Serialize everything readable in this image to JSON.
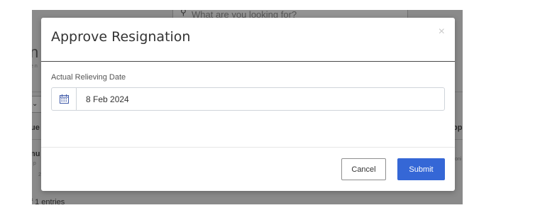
{
  "background": {
    "search_placeholder": "What are you looking for?",
    "fragment_heading": "n",
    "fragment_header_left": "ue",
    "fragment_header_right": "pp",
    "fragment_row_name": "nu",
    "fragment_row_sub": "d p",
    "fragment_row_num": "2",
    "fragment_right_small": "oni",
    "fragment_entries": "f 1 entries",
    "fragment_tiny": "e n"
  },
  "modal": {
    "title": "Approve Resignation",
    "close_symbol": "×",
    "field_label": "Actual Relieving Date",
    "date_value": "8 Feb 2024",
    "cancel_label": "Cancel",
    "submit_label": "Submit"
  },
  "colors": {
    "primary": "#3567d6",
    "backdrop": "#8a8a8a"
  }
}
